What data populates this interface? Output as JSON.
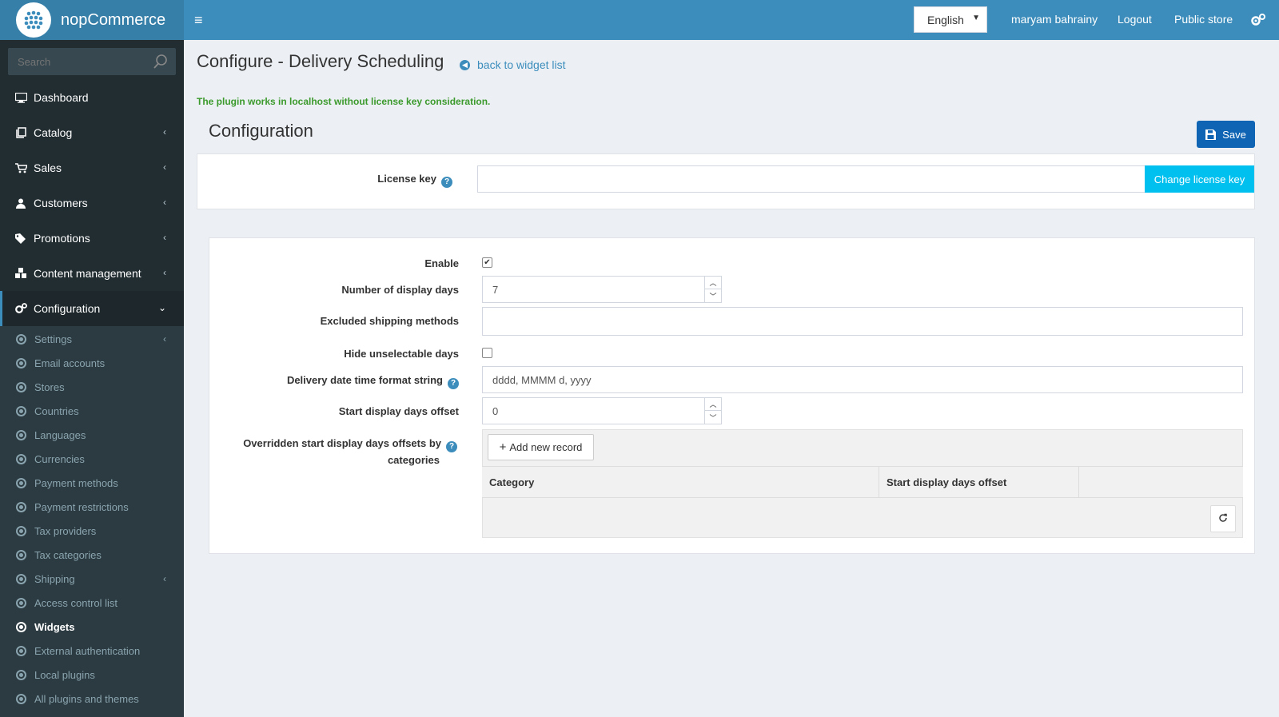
{
  "header": {
    "brand": "nopCommerce",
    "language": "English",
    "user": "maryam bahrainy",
    "logout": "Logout",
    "public_store": "Public store"
  },
  "sidebar": {
    "search_placeholder": "Search",
    "menu": [
      {
        "label": "Dashboard",
        "icon": "desktop-icon"
      },
      {
        "label": "Catalog",
        "icon": "book-icon"
      },
      {
        "label": "Sales",
        "icon": "cart-icon"
      },
      {
        "label": "Customers",
        "icon": "user-icon"
      },
      {
        "label": "Promotions",
        "icon": "tags-icon"
      },
      {
        "label": "Content management",
        "icon": "cubes-icon"
      },
      {
        "label": "Configuration",
        "icon": "gears-icon"
      }
    ],
    "submenu": [
      "Settings",
      "Email accounts",
      "Stores",
      "Countries",
      "Languages",
      "Currencies",
      "Payment methods",
      "Payment restrictions",
      "Tax providers",
      "Tax categories",
      "Shipping",
      "Access control list",
      "Widgets",
      "External authentication",
      "Local plugins",
      "All plugins and themes"
    ]
  },
  "page": {
    "title": "Configure - Delivery Scheduling",
    "back_link": "back to widget list",
    "license_note": "The plugin works in localhost without license key consideration.",
    "config_title": "Configuration",
    "save_label": "Save"
  },
  "license": {
    "label": "License key",
    "value": "",
    "button": "Change license key"
  },
  "form": {
    "enable_label": "Enable",
    "enable_checked": true,
    "display_days_label": "Number of display days",
    "display_days_value": "7",
    "excluded_label": "Excluded shipping methods",
    "hide_label": "Hide unselectable days",
    "hide_checked": false,
    "format_label": "Delivery date time format string",
    "format_value": "dddd, MMMM d, yyyy",
    "offset_label": "Start display days offset",
    "offset_value": "0",
    "overridden_label_1": "Overridden start display days offsets by",
    "overridden_label_2": "categories"
  },
  "grid": {
    "add_label": "Add new record",
    "columns": [
      "Category",
      "Start display days offset"
    ]
  },
  "colors": {
    "header": "#3c8dbc",
    "sidebar": "#222d32",
    "save": "#0f65b3",
    "change": "#00c0ef",
    "note": "#3c9a2c"
  }
}
